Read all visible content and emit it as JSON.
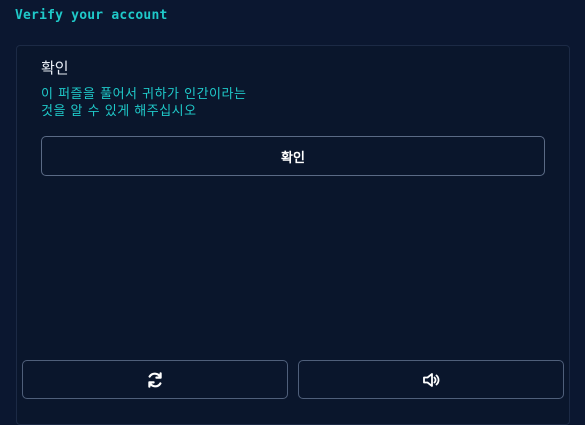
{
  "header": {
    "title": "Verify your account"
  },
  "challenge": {
    "title": "확인",
    "instructions_line1": "이 퍼즐을 풀어서 귀하가 인간이라는",
    "instructions_line2": "것을 알 수 있게 해주십시오",
    "confirm_label": "확인"
  },
  "footer": {
    "refresh_icon": "refresh-icon",
    "audio_icon": "speaker-icon"
  },
  "colors": {
    "background": "#0b1730",
    "accent": "#1fc9c9",
    "border": "#4f5f7a"
  }
}
